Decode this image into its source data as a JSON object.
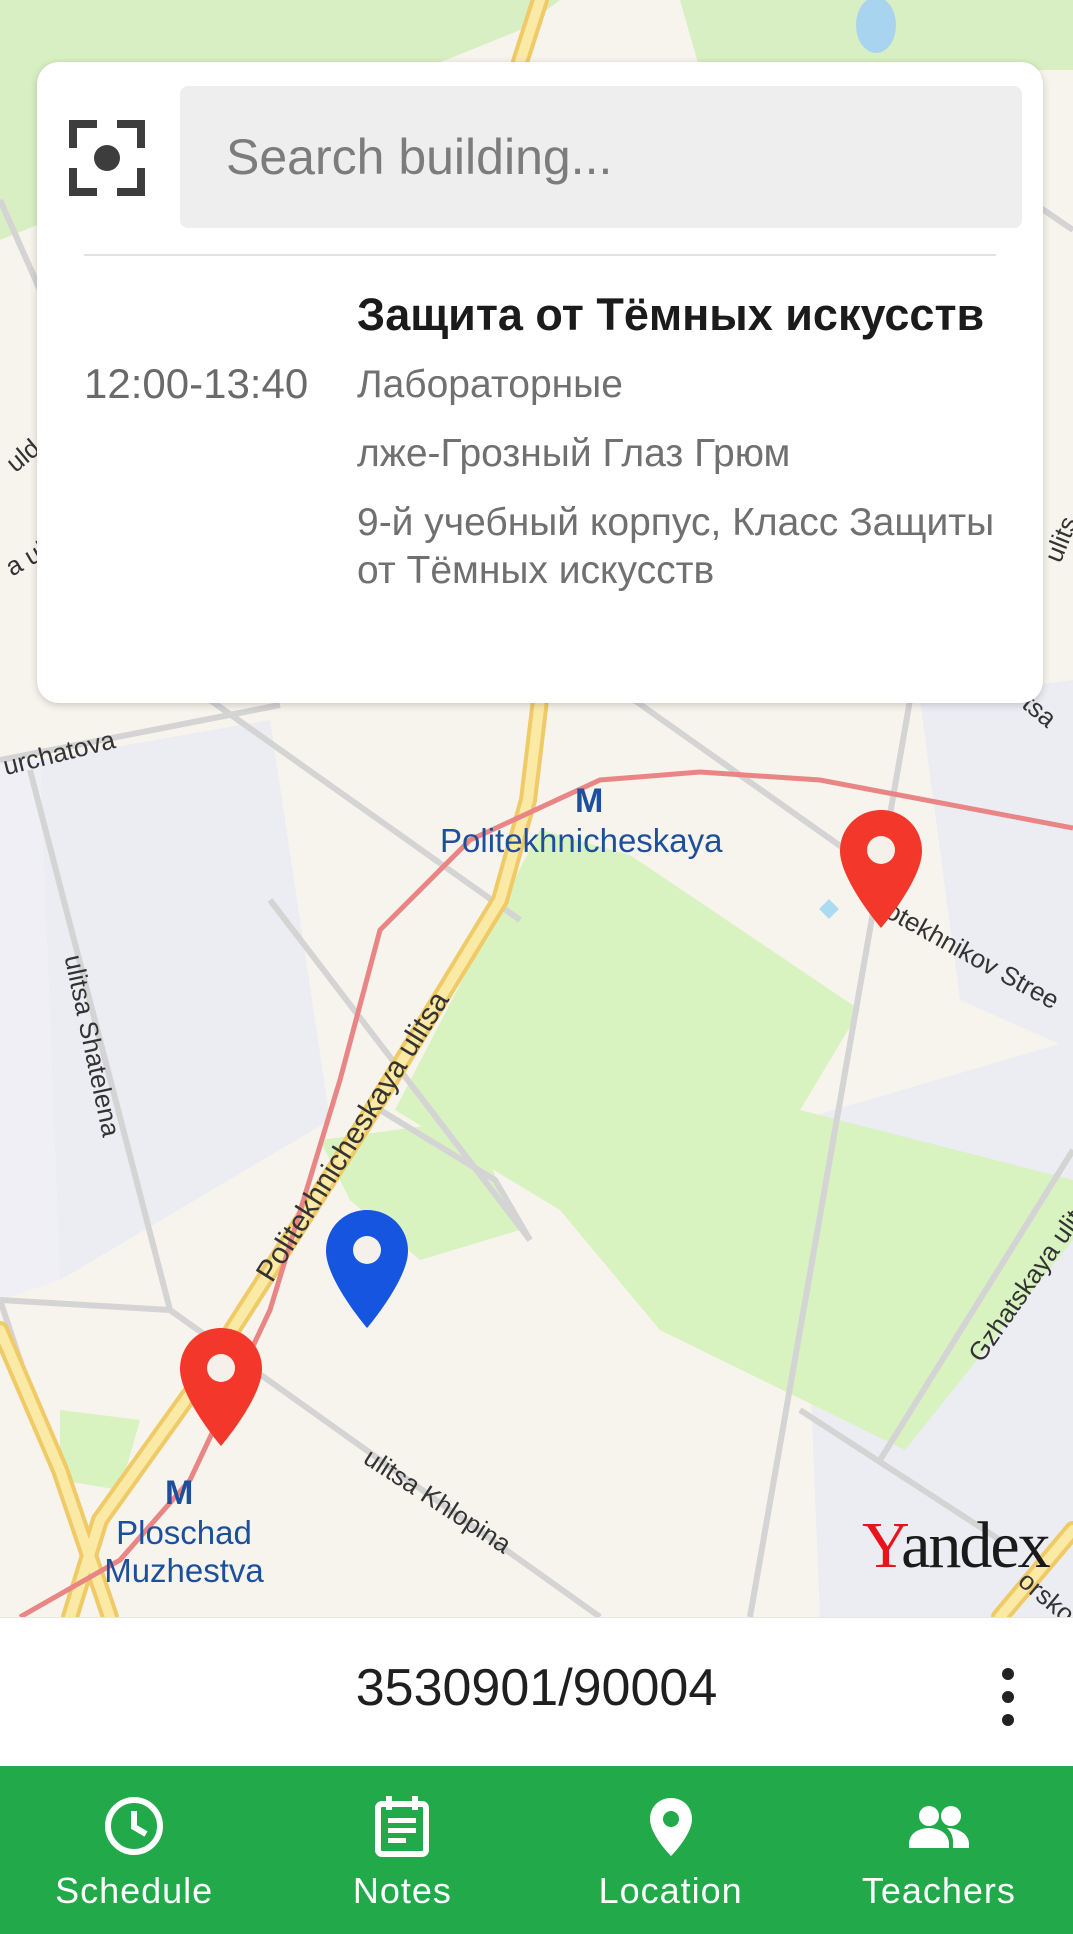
{
  "search": {
    "placeholder": "Search building..."
  },
  "lesson": {
    "time": "12:00-13:40",
    "title": "Защита от Тёмных искусств",
    "type": "Лабораторные",
    "teacher": "лже-Грозный Глаз Грюм",
    "location": "9-й учебный корпус, Класс Защиты от Тёмных искусств"
  },
  "map": {
    "streets": {
      "kurchatova": "urchatova",
      "politekhnicheskaya": "Politekhnicheskaya ulitsa",
      "shatelena": "ulitsa Shatelena",
      "khlopina": "ulitsa Khlopina",
      "polytechnikov": "otekhnikov Stree",
      "gzhatskaya": "Gzhatskaya ulitsa",
      "left_top": "uld",
      "left_mid": "a ul",
      "right_top": "ulits",
      "right_mid": "tsa",
      "right_bottom": "orsko",
      "top_partial": "a"
    },
    "metro": {
      "politekhnicheskaya": "Politekhnicheskaya",
      "ploschad_line1": "Ploschad",
      "ploschad_line2": "Muzhestva"
    },
    "metro_icon": "M",
    "logo_first": "Y",
    "logo_rest": "andex",
    "colors": {
      "red_pin": "#f4372b",
      "blue_pin": "#1655e0",
      "park": "#d8f2c0",
      "road_major": "#f7d776",
      "rail": "#e98585",
      "block": "#ededf4"
    }
  },
  "group": {
    "number": "3530901/90004",
    "more_icon": "more-vert-icon"
  },
  "nav": {
    "items": [
      {
        "label": "Schedule",
        "icon": "clock-icon"
      },
      {
        "label": "Notes",
        "icon": "notes-icon"
      },
      {
        "label": "Location",
        "icon": "location-pin-icon"
      },
      {
        "label": "Teachers",
        "icon": "people-icon"
      }
    ],
    "color": "#21a94a"
  }
}
